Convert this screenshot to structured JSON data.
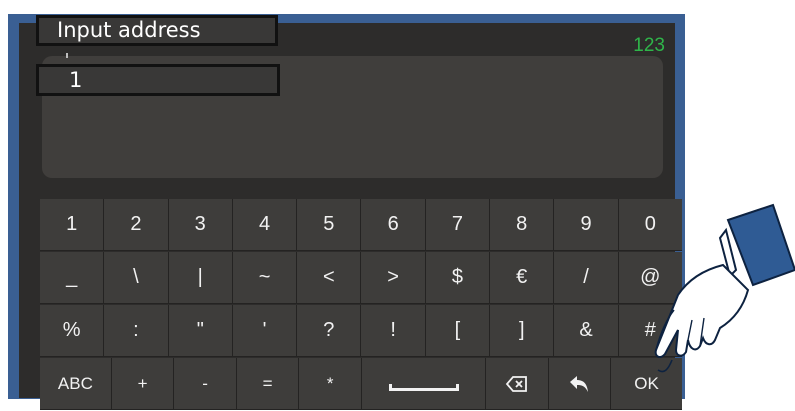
{
  "header": {
    "mode_label": "123"
  },
  "callouts": {
    "title": "Input address",
    "value": "1"
  },
  "keyboard": {
    "rows": [
      [
        "1",
        "2",
        "3",
        "4",
        "5",
        "6",
        "7",
        "8",
        "9",
        "0"
      ],
      [
        "_",
        "\\",
        "|",
        "~",
        "<",
        ">",
        "$",
        "€",
        "/",
        "@"
      ],
      [
        "%",
        ":",
        "\"",
        "'",
        "?",
        "!",
        "[",
        "]",
        "&",
        "#"
      ],
      [
        "ABC",
        "+",
        "-",
        "=",
        "*",
        "space",
        "backspace",
        "return",
        "OK"
      ]
    ]
  },
  "colors": {
    "frame": "#3a5f93",
    "screen": "#2d2c2b",
    "key": "#3e3d3b",
    "accent_green": "#2fb54a"
  },
  "icons": {
    "backspace": "backspace-icon",
    "return": "return-arrow-icon",
    "space": "space-bar-icon",
    "hand": "pointing-hand-icon"
  }
}
